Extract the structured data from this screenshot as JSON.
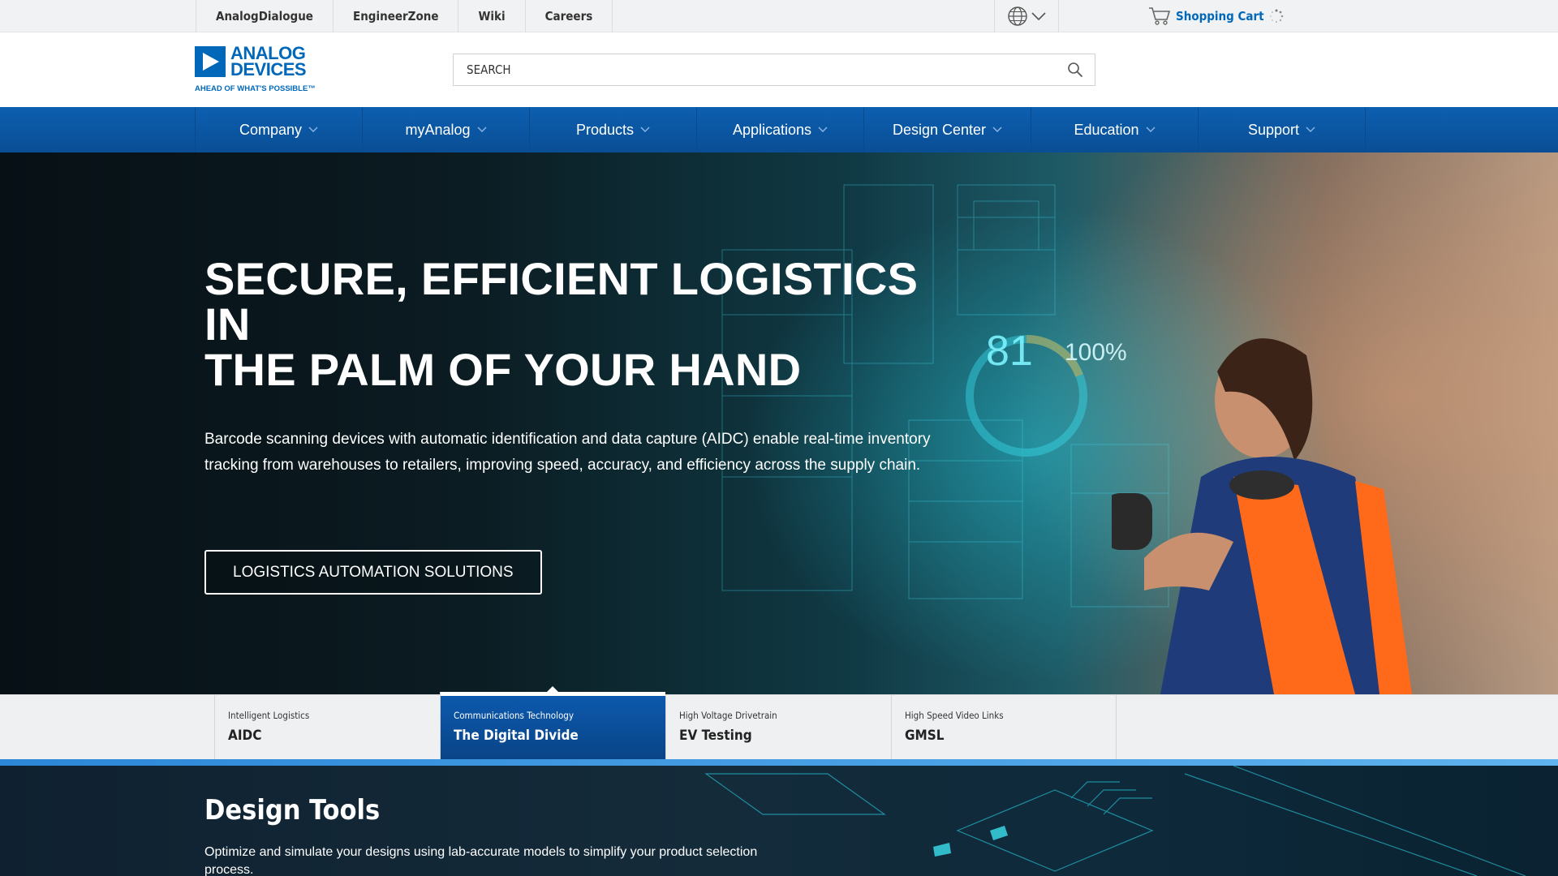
{
  "util_bar": {
    "links": [
      "AnalogDialogue",
      "EngineerZone",
      "Wiki",
      "Careers"
    ],
    "cart_label": "Shopping Cart"
  },
  "header": {
    "logo_line1": "ANALOG",
    "logo_line2": "DEVICES",
    "logo_tagline": "AHEAD OF WHAT'S POSSIBLE™",
    "search_placeholder": "SEARCH"
  },
  "nav": {
    "items": [
      "Company",
      "myAnalog",
      "Products",
      "Applications",
      "Design Center",
      "Education",
      "Support"
    ]
  },
  "hero": {
    "title_line1": "SECURE, EFFICIENT LOGISTICS IN",
    "title_line2": "THE PALM OF YOUR HAND",
    "body": "Barcode scanning devices with automatic identification and data capture (AIDC) enable real-time inventory tracking from warehouses to retailers, improving speed, accuracy, and efficiency across the supply chain.",
    "cta_label": "LOGISTICS AUTOMATION SOLUTIONS",
    "overlay_value": "81",
    "overlay_efficiency": "100%"
  },
  "carousel_tabs": [
    {
      "category": "Intelligent Logistics",
      "title": "AIDC",
      "active": false
    },
    {
      "category": "Communications Technology",
      "title": "The Digital Divide",
      "active": true
    },
    {
      "category": "High Voltage Drivetrain",
      "title": "EV Testing",
      "active": false
    },
    {
      "category": "High Speed Video Links",
      "title": "GMSL",
      "active": false
    }
  ],
  "design_tools": {
    "title": "Design Tools",
    "body": "Optimize and simulate your designs using lab-accurate models to simplify your product selection process."
  },
  "colors": {
    "brand_blue": "#0067b9",
    "nav_blue": "#0c5fb0",
    "tab_active": "#0d5ab0"
  }
}
